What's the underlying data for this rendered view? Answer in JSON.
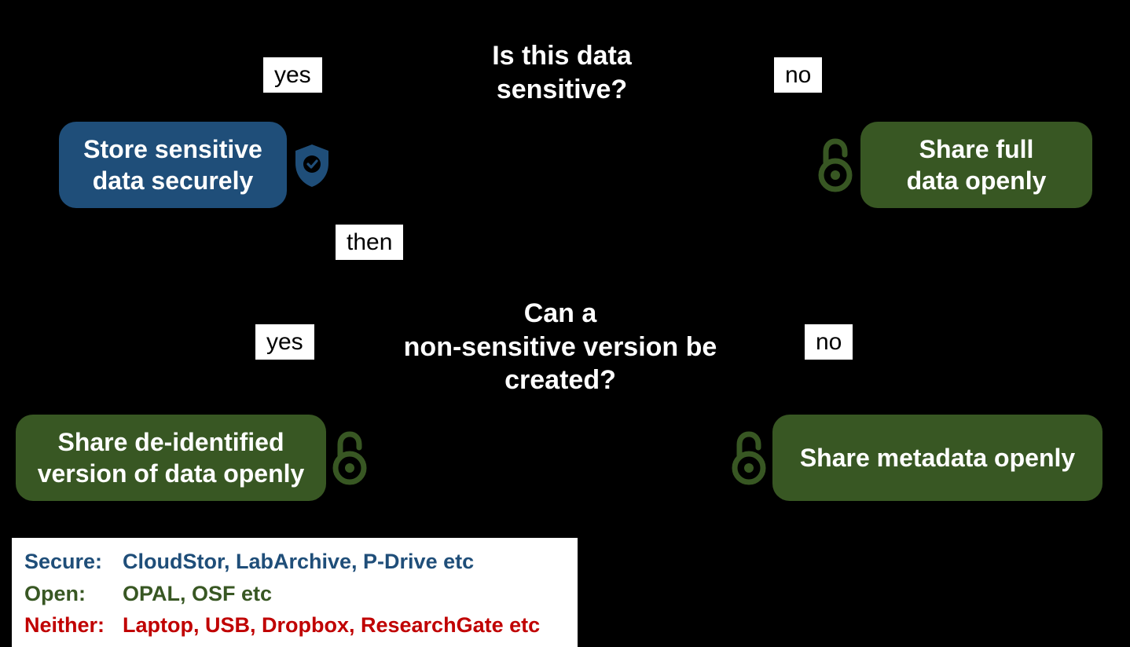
{
  "diagram": {
    "question1": "Is this data\nsensitive?",
    "question2": "Can a\nnon-sensitive version be\ncreated?",
    "labels": {
      "yes1": "yes",
      "no1": "no",
      "then": "then",
      "yes2": "yes",
      "no2": "no"
    },
    "nodes": {
      "store_secure": "Store sensitive\ndata securely",
      "share_full": "Share full\ndata openly",
      "share_deid": "Share de-identified\nversion of data openly",
      "share_meta": "Share metadata openly"
    }
  },
  "legend": {
    "secure_key": "Secure:",
    "secure_val": "CloudStor, LabArchive, P-Drive etc",
    "open_key": "Open:",
    "open_val": "OPAL, OSF etc",
    "neither_key": "Neither:",
    "neither_val": "Laptop, USB, Dropbox, ResearchGate etc"
  }
}
